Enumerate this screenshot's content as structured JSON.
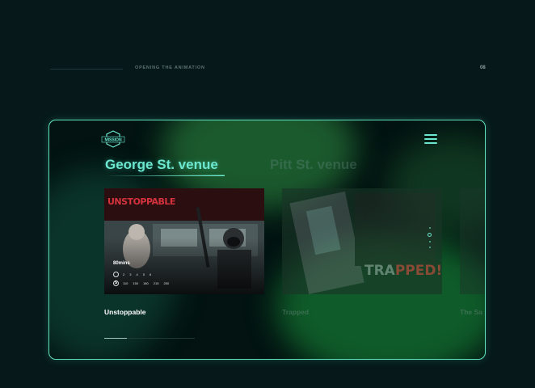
{
  "header": {
    "section_label": "OPENING THE ANIMATION",
    "page_number": "08"
  },
  "logo": {
    "text": "MISSION"
  },
  "tabs": [
    {
      "label": "George St. venue",
      "active": true
    },
    {
      "label": "Pitt St. venue",
      "active": false
    }
  ],
  "cards": [
    {
      "poster_title": "UNSTOPPABLE",
      "name": "Unstoppable",
      "duration": "80mins",
      "players": [
        "2",
        "3",
        "4",
        "5",
        "6"
      ],
      "prices": [
        "110",
        "150",
        "180",
        "215",
        "250"
      ]
    },
    {
      "poster_title": "TRAPPED!",
      "poster_title_a": "TRA",
      "poster_title_b": "PPED!",
      "name": "Trapped"
    },
    {
      "name": "The Sa"
    }
  ],
  "pagination": {
    "total": 4,
    "current": 2
  },
  "progress": {
    "fraction": 0.25
  },
  "colors": {
    "accent": "#6de8d0",
    "background": "#06181a",
    "frame_border": "#5fe3bf"
  }
}
